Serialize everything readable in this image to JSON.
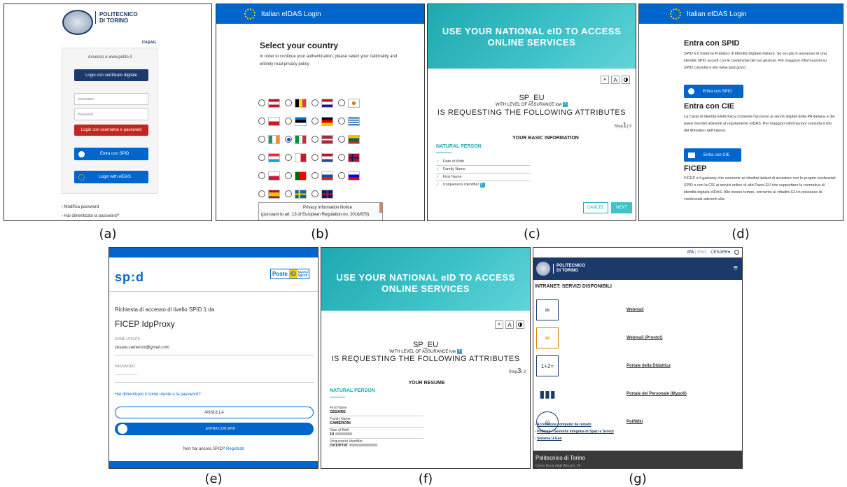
{
  "captions": [
    "(a)",
    "(b)",
    "(c)",
    "(d)",
    "(e)",
    "(f)",
    "(g)"
  ],
  "a": {
    "uni_line1": "POLITECNICO",
    "uni_line2": "DI TORINO",
    "lang": "ITA|ENG",
    "access": "Accesso a www.polito.it",
    "cert_btn": "Login con certificato digitale",
    "username_ph": "Username",
    "password_ph": "Password",
    "login_btn": "Login con username e password",
    "spid_btn": "Entra con SPID",
    "eidas_btn": "Login with eIDAS",
    "link1": "› Modifica password",
    "link2": "› Hai dimenticato la password?"
  },
  "b": {
    "bar": "Italian eIDAS Login",
    "title": "Select your country",
    "desc": "In order to continue your authentication, please select your nationality and entirely read privacy policy",
    "notice_title": "Privacy  Information Notice",
    "notice_text": "(pursuant to art. 13 of European Regulation no. 2016/679)"
  },
  "c": {
    "hero": "USE YOUR NATIONAL  eID TO ACCESS ONLINE SERVICES",
    "sp": "SP_EU",
    "loa": "WITH LEVEL OF ASSURANCE low",
    "requesting": "IS REQUESTING THE FOLLOWING ATTRIBUTES",
    "step_prefix": "Step",
    "step_num": "1",
    "step_total": "| 3",
    "section": "YOUR BASIC INFORMATION",
    "np": "NATURAL PERSON",
    "attrs": [
      "Date of Birth",
      "Family Name",
      "First Name",
      "Uniqueness Identifier"
    ],
    "cancel": "CANCEL",
    "next": "NEXT",
    "font_a_small": "A",
    "font_a_big": "A"
  },
  "d": {
    "bar": "Italian eIDAS Login",
    "h1": "Entra con SPID",
    "p1": "SPID è il Sistema Pubblico di Identità Digitale italiano. Se sei già in possesso di una identità SPID accedi con le credenziali del tuo gestore. Per maggiori informazioni su SPID consulta il sito www.spid.gov.it.",
    "btn1": "Entra con SPID",
    "h2": "Entra con CIE",
    "p2": "La Carta di Identità Elettronica consente l'accesso ai servizi digitali della PA italiana e dei paesi membri aderenti al regolamento eIDAS. Per maggiori informazioni consulta il sito del Ministero dell'Interno.",
    "btn2": "Entra con CIE",
    "h3": "FICEP",
    "p3": "FICEP è il gateway che consente ai cittadini italiani di accedere con le proprie credenziali SPID o con la CIE ai servizi online di altri Paesi EU che supportano la normativa di identità digitale eIDAS. Allo stesso tempo, consente ai cittadini EU in possesso di credenziali aderenti alla"
  },
  "e": {
    "logo": "sp:d",
    "poste": "Poste",
    "id": "ID",
    "nuovo": "NUOVO",
    "spid_small": "sp:d",
    "request": "Richiesta di accesso di livello SPID 1 da",
    "sp_name": "FICEP IdpProxy",
    "user_label": "NOME UTENTE",
    "user_value": "cesare.cameroni@gmail.com",
    "pw_label": "PASSWORD",
    "pw_value": "················",
    "forgot": "Hai dimenticato il nome utente o la password?",
    "cancel": "ANNULLA",
    "enter": "ENTRA CON SPID",
    "no_spid": "Non hai ancora SPID?",
    "register": "Registrati"
  },
  "f": {
    "hero": "USE YOUR NATIONAL  eID TO ACCESS ONLINE SERVICES",
    "sp": "SP_EU",
    "loa": "WITH LEVEL OF ASSURANCE low",
    "requesting": "IS REQUESTING THE FOLLOWING ATTRIBUTES",
    "step_prefix": "Step",
    "step_num": "3",
    "step_total": "| 3",
    "section": "YOUR RESUME",
    "np": "NATURAL PERSON",
    "fields": [
      {
        "label": "First Name",
        "value": "CESARE"
      },
      {
        "label": "Family Name",
        "value": "CAMERONI"
      },
      {
        "label": "Date of Birth",
        "value": "19"
      },
      {
        "label": "Uniqueness Identifier",
        "value": "IT/IT/PT/IT"
      }
    ],
    "font_a_small": "A",
    "font_a_big": "A"
  },
  "g": {
    "lang_ita": "ITA",
    "lang_sep": " | ",
    "lang_eng": "ENG",
    "user": "CESARE▾",
    "uni_line1": "POLITECNICO",
    "uni_line2": "DI TORINO",
    "heading": "INTRANET: SERVIZI DISPONIBILI",
    "services": [
      "Webmail",
      "Webmail (Pronto!)",
      "Portale della Didattica",
      "Portale del Personale (Mypoli)",
      "PoliWiki"
    ],
    "links": [
      "Accensione computer da remoto",
      "Polimap - Gestione Integrata di Spazi e Servizi",
      "Sistema U-Gov"
    ],
    "footer": "Politecnico di Torino",
    "footer2": "Corso Duca degli Abruzzi, 24"
  }
}
